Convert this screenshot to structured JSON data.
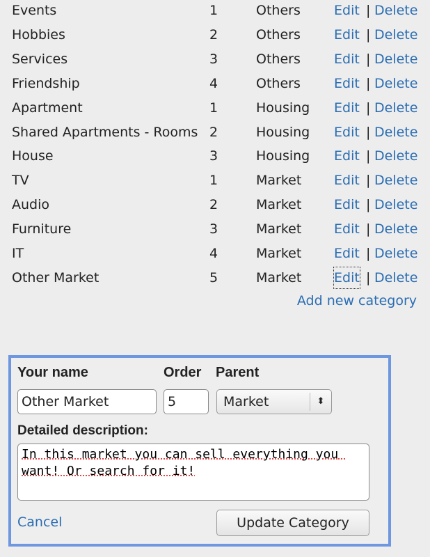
{
  "categories": [
    {
      "name": "Events",
      "order": "1",
      "parent": "Others"
    },
    {
      "name": "Hobbies",
      "order": "2",
      "parent": "Others"
    },
    {
      "name": "Services",
      "order": "3",
      "parent": "Others"
    },
    {
      "name": "Friendship",
      "order": "4",
      "parent": "Others"
    },
    {
      "name": "Apartment",
      "order": "1",
      "parent": "Housing"
    },
    {
      "name": "Shared Apartments - Rooms",
      "order": "2",
      "parent": "Housing"
    },
    {
      "name": "House",
      "order": "3",
      "parent": "Housing"
    },
    {
      "name": "TV",
      "order": "1",
      "parent": "Market"
    },
    {
      "name": "Audio",
      "order": "2",
      "parent": "Market"
    },
    {
      "name": "Furniture",
      "order": "3",
      "parent": "Market"
    },
    {
      "name": "IT",
      "order": "4",
      "parent": "Market"
    },
    {
      "name": "Other Market",
      "order": "5",
      "parent": "Market"
    }
  ],
  "labels": {
    "edit": "Edit",
    "separator": "|",
    "delete": "Delete",
    "add_new": "Add new category"
  },
  "form": {
    "name_label": "Your name",
    "order_label": "Order",
    "parent_label": "Parent",
    "name_value": "Other Market",
    "order_value": "5",
    "parent_value": "Market",
    "description_label": "Detailed description:",
    "description_value": "In this market you can sell everything you want! Or search for it!",
    "cancel": "Cancel",
    "submit": "Update Category"
  },
  "colors": {
    "link": "#2a6db3",
    "form_border": "#6d97e0"
  }
}
